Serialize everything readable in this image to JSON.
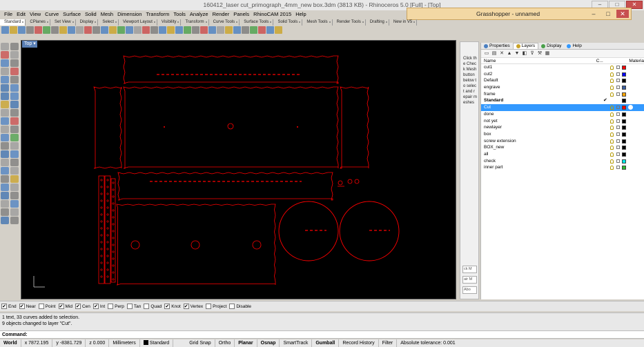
{
  "window": {
    "title": "160412_laser cut_primograph_4mm_new box.3dm (3813 KB) - Rhinoceros 5.0 [Full] - [Top]"
  },
  "grasshopper": {
    "title": "Grasshopper - unnamed"
  },
  "menu": [
    "File",
    "Edit",
    "View",
    "Curve",
    "Surface",
    "Solid",
    "Mesh",
    "Dimension",
    "Transform",
    "Tools",
    "Analyze",
    "Render",
    "Panels",
    "RhinoCAM 2015",
    "Help"
  ],
  "toolbar_tabs": [
    "Standard",
    "CPlanes",
    "Set View",
    "Display",
    "Select",
    "Viewport Layout",
    "Visibility",
    "Transform",
    "Curve Tools",
    "Surface Tools",
    "Solid Tools",
    "Mesh Tools",
    "Render Tools",
    "Drafting",
    "New in V5"
  ],
  "viewport": {
    "label": "Top"
  },
  "command_strip": {
    "text": "Click the Check Mesh button below to select and repair meshes",
    "fields": [
      "ck M",
      "air M",
      "Abo"
    ]
  },
  "panel": {
    "tabs": [
      "Properties",
      "Layers",
      "Display",
      "Help"
    ],
    "active_tab": "Layers",
    "columns": {
      "name": "Name",
      "c": "C...",
      "material": "Materia"
    },
    "layers": [
      {
        "name": "cut1",
        "color": "#ff0000"
      },
      {
        "name": "cut2",
        "color": "#0000ff"
      },
      {
        "name": "Default",
        "color": "#000000"
      },
      {
        "name": "engrave",
        "color": "#3a5f9f"
      },
      {
        "name": "frame",
        "color": "#ffa500"
      },
      {
        "name": "Standard",
        "color": "#000000",
        "current": true
      },
      {
        "name": "Cut",
        "color": "#ff0000",
        "selected": true
      },
      {
        "name": "done",
        "color": "#000000"
      },
      {
        "name": "not yet",
        "color": "#000000"
      },
      {
        "name": "newlayer",
        "color": "#000000"
      },
      {
        "name": "box",
        "color": "#000000"
      },
      {
        "name": "screw extension",
        "color": "#000000"
      },
      {
        "name": "BOX_new",
        "color": "#000000"
      },
      {
        "name": "all",
        "color": "#000000"
      },
      {
        "name": "check",
        "color": "#00e5e5"
      },
      {
        "name": "inner part",
        "color": "#2eb82e"
      }
    ]
  },
  "osnaps": [
    {
      "label": "End",
      "on": true
    },
    {
      "label": "Near",
      "on": true
    },
    {
      "label": "Point",
      "on": false
    },
    {
      "label": "Mid",
      "on": true
    },
    {
      "label": "Cen",
      "on": true
    },
    {
      "label": "Int",
      "on": true
    },
    {
      "label": "Perp",
      "on": false
    },
    {
      "label": "Tan",
      "on": false
    },
    {
      "label": "Quad",
      "on": false
    },
    {
      "label": "Knot",
      "on": true
    },
    {
      "label": "Vertex",
      "on": true
    },
    {
      "label": "Project",
      "on": false
    },
    {
      "label": "Disable",
      "on": false
    }
  ],
  "history": [
    "1 text, 33 curves added to selection.",
    "9 objects changed to layer \"Cut\"."
  ],
  "command": {
    "prompt": "Command:"
  },
  "status": {
    "cplane": "World",
    "x": "x 7872.195",
    "y": "y -8381.729",
    "z": "z 0.000",
    "units": "Millimeters",
    "layer": "Standard",
    "grid_snap": "Grid Snap",
    "ortho": "Ortho",
    "planar": "Planar",
    "osnap": "Osnap",
    "smarttrack": "SmartTrack",
    "gumball": "Gumball",
    "record_history": "Record History",
    "filter": "Filter",
    "tolerance": "Absolute tolerance: 0.001"
  },
  "colors": {
    "accent": "#3399ff",
    "drawing": "#ff0000",
    "viewport_bg": "#000000"
  }
}
